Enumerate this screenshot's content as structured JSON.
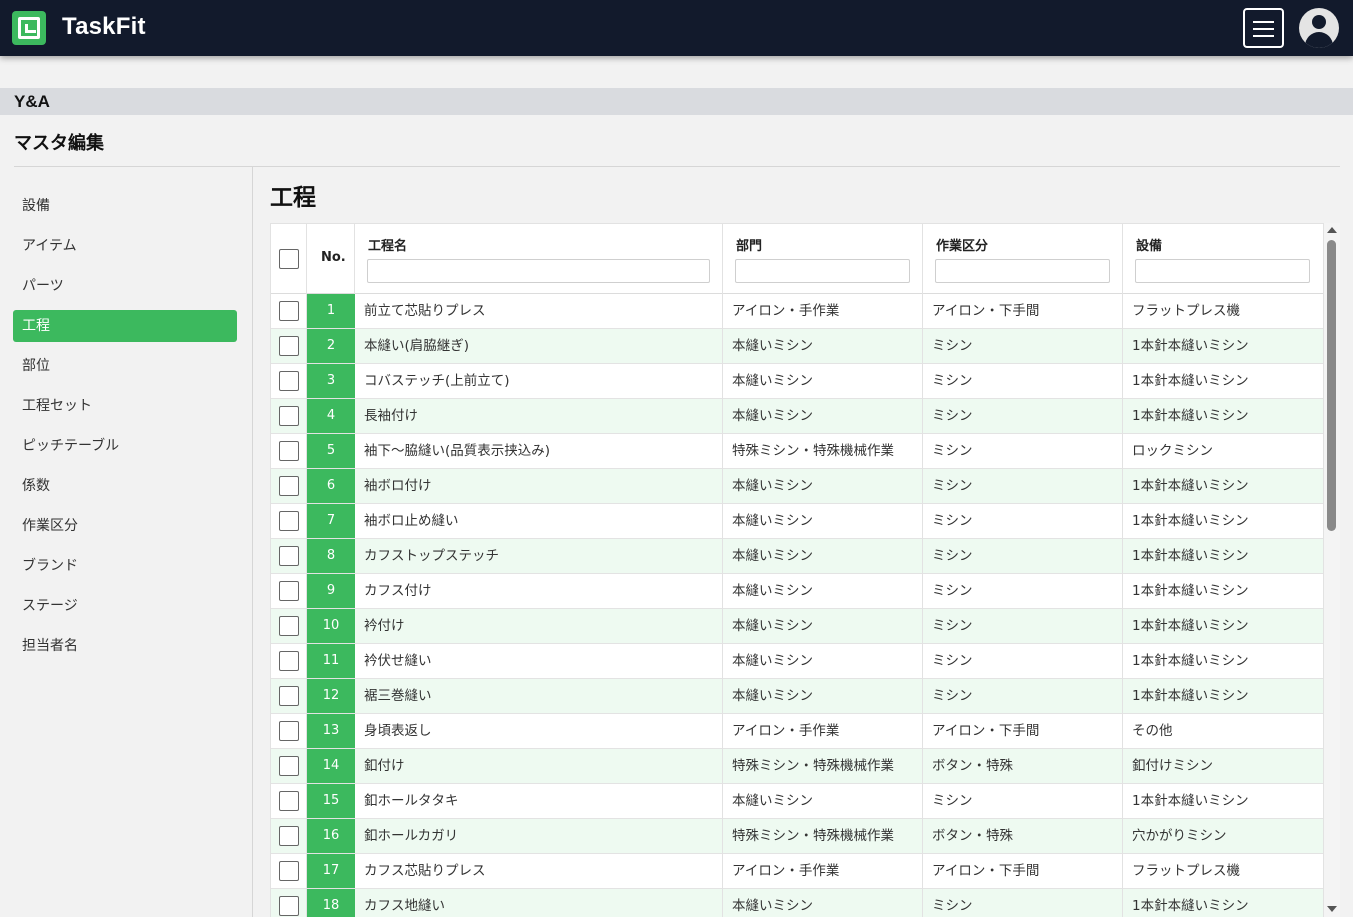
{
  "app": {
    "title": "TaskFit",
    "logo_icon": "sewing-machine-icon",
    "menu_icon": "hamburger-menu-icon",
    "avatar_icon": "user-avatar-icon"
  },
  "org": {
    "name": "Y&A"
  },
  "section": {
    "title": "マスタ編集"
  },
  "sidebar": {
    "active_index": 3,
    "items": [
      "設備",
      "アイテム",
      "パーツ",
      "工程",
      "部位",
      "工程セット",
      "ピッチテーブル",
      "係数",
      "作業区分",
      "ブランド",
      "ステージ",
      "担当者名"
    ]
  },
  "page": {
    "heading": "工程"
  },
  "colors": {
    "accent": "#3cb95e",
    "header_bg": "#121a2c",
    "row_alt": "#eefaf1"
  },
  "table": {
    "columns": {
      "no": "No.",
      "name": "工程名",
      "dept": "部門",
      "work_type": "作業区分",
      "equipment": "設備"
    },
    "filters": {
      "name": "",
      "dept": "",
      "work_type": "",
      "equipment": ""
    },
    "rows": [
      {
        "no": "1",
        "name": "前立て芯貼りプレス",
        "dept": "アイロン・手作業",
        "work_type": "アイロン・下手間",
        "equipment": "フラットプレス機"
      },
      {
        "no": "2",
        "name": "本縫い(肩脇継ぎ)",
        "dept": "本縫いミシン",
        "work_type": "ミシン",
        "equipment": "1本針本縫いミシン"
      },
      {
        "no": "3",
        "name": "コバステッチ(上前立て)",
        "dept": "本縫いミシン",
        "work_type": "ミシン",
        "equipment": "1本針本縫いミシン"
      },
      {
        "no": "4",
        "name": "長袖付け",
        "dept": "本縫いミシン",
        "work_type": "ミシン",
        "equipment": "1本針本縫いミシン"
      },
      {
        "no": "5",
        "name": "袖下〜脇縫い(品質表示挟込み)",
        "dept": "特殊ミシン・特殊機械作業",
        "work_type": "ミシン",
        "equipment": "ロックミシン"
      },
      {
        "no": "6",
        "name": "袖ボロ付け",
        "dept": "本縫いミシン",
        "work_type": "ミシン",
        "equipment": "1本針本縫いミシン"
      },
      {
        "no": "7",
        "name": "袖ボロ止め縫い",
        "dept": "本縫いミシン",
        "work_type": "ミシン",
        "equipment": "1本針本縫いミシン"
      },
      {
        "no": "8",
        "name": "カフストップステッチ",
        "dept": "本縫いミシン",
        "work_type": "ミシン",
        "equipment": "1本針本縫いミシン"
      },
      {
        "no": "9",
        "name": "カフス付け",
        "dept": "本縫いミシン",
        "work_type": "ミシン",
        "equipment": "1本針本縫いミシン"
      },
      {
        "no": "10",
        "name": "衿付け",
        "dept": "本縫いミシン",
        "work_type": "ミシン",
        "equipment": "1本針本縫いミシン"
      },
      {
        "no": "11",
        "name": "衿伏せ縫い",
        "dept": "本縫いミシン",
        "work_type": "ミシン",
        "equipment": "1本針本縫いミシン"
      },
      {
        "no": "12",
        "name": "裾三巻縫い",
        "dept": "本縫いミシン",
        "work_type": "ミシン",
        "equipment": "1本針本縫いミシン"
      },
      {
        "no": "13",
        "name": "身頃表返し",
        "dept": "アイロン・手作業",
        "work_type": "アイロン・下手間",
        "equipment": "その他"
      },
      {
        "no": "14",
        "name": "釦付け",
        "dept": "特殊ミシン・特殊機械作業",
        "work_type": "ボタン・特殊",
        "equipment": "釦付けミシン"
      },
      {
        "no": "15",
        "name": "釦ホールタタキ",
        "dept": "本縫いミシン",
        "work_type": "ミシン",
        "equipment": "1本針本縫いミシン"
      },
      {
        "no": "16",
        "name": "釦ホールカガリ",
        "dept": "特殊ミシン・特殊機械作業",
        "work_type": "ボタン・特殊",
        "equipment": "穴かがりミシン"
      },
      {
        "no": "17",
        "name": "カフス芯貼りプレス",
        "dept": "アイロン・手作業",
        "work_type": "アイロン・下手間",
        "equipment": "フラットプレス機"
      },
      {
        "no": "18",
        "name": "カフス地縫い",
        "dept": "本縫いミシン",
        "work_type": "ミシン",
        "equipment": "1本針本縫いミシン"
      }
    ]
  }
}
